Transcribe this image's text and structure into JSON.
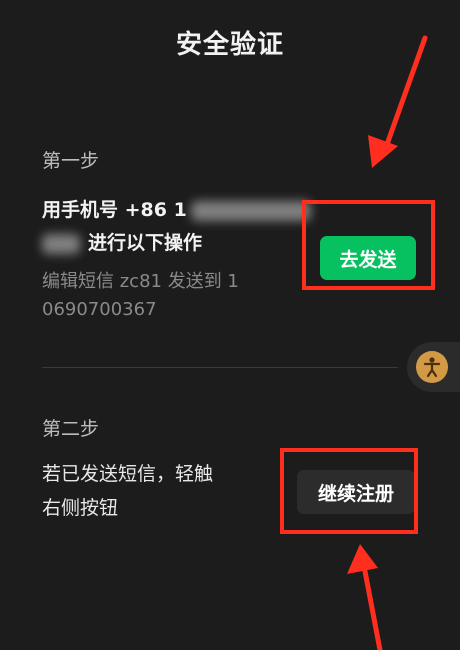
{
  "header": {
    "title": "安全验证"
  },
  "step1": {
    "label": "第一步",
    "line1": "用手机号 +86 1",
    "line2": "进行以下操作",
    "hint_line1": "编辑短信 zc81 发送到 1",
    "hint_line2": "0690700367",
    "send_button": "去发送"
  },
  "step2": {
    "label": "第二步",
    "line1": "若已发送短信，轻触",
    "line2": "右侧按钮",
    "continue_button": "继续注册"
  },
  "colors": {
    "background": "#1c1c1c",
    "send_button": "#07c160",
    "annotation": "#ff2e1f",
    "float_icon": "#d39a45"
  },
  "icons": {
    "floating_button": "accessibility-person-icon"
  }
}
